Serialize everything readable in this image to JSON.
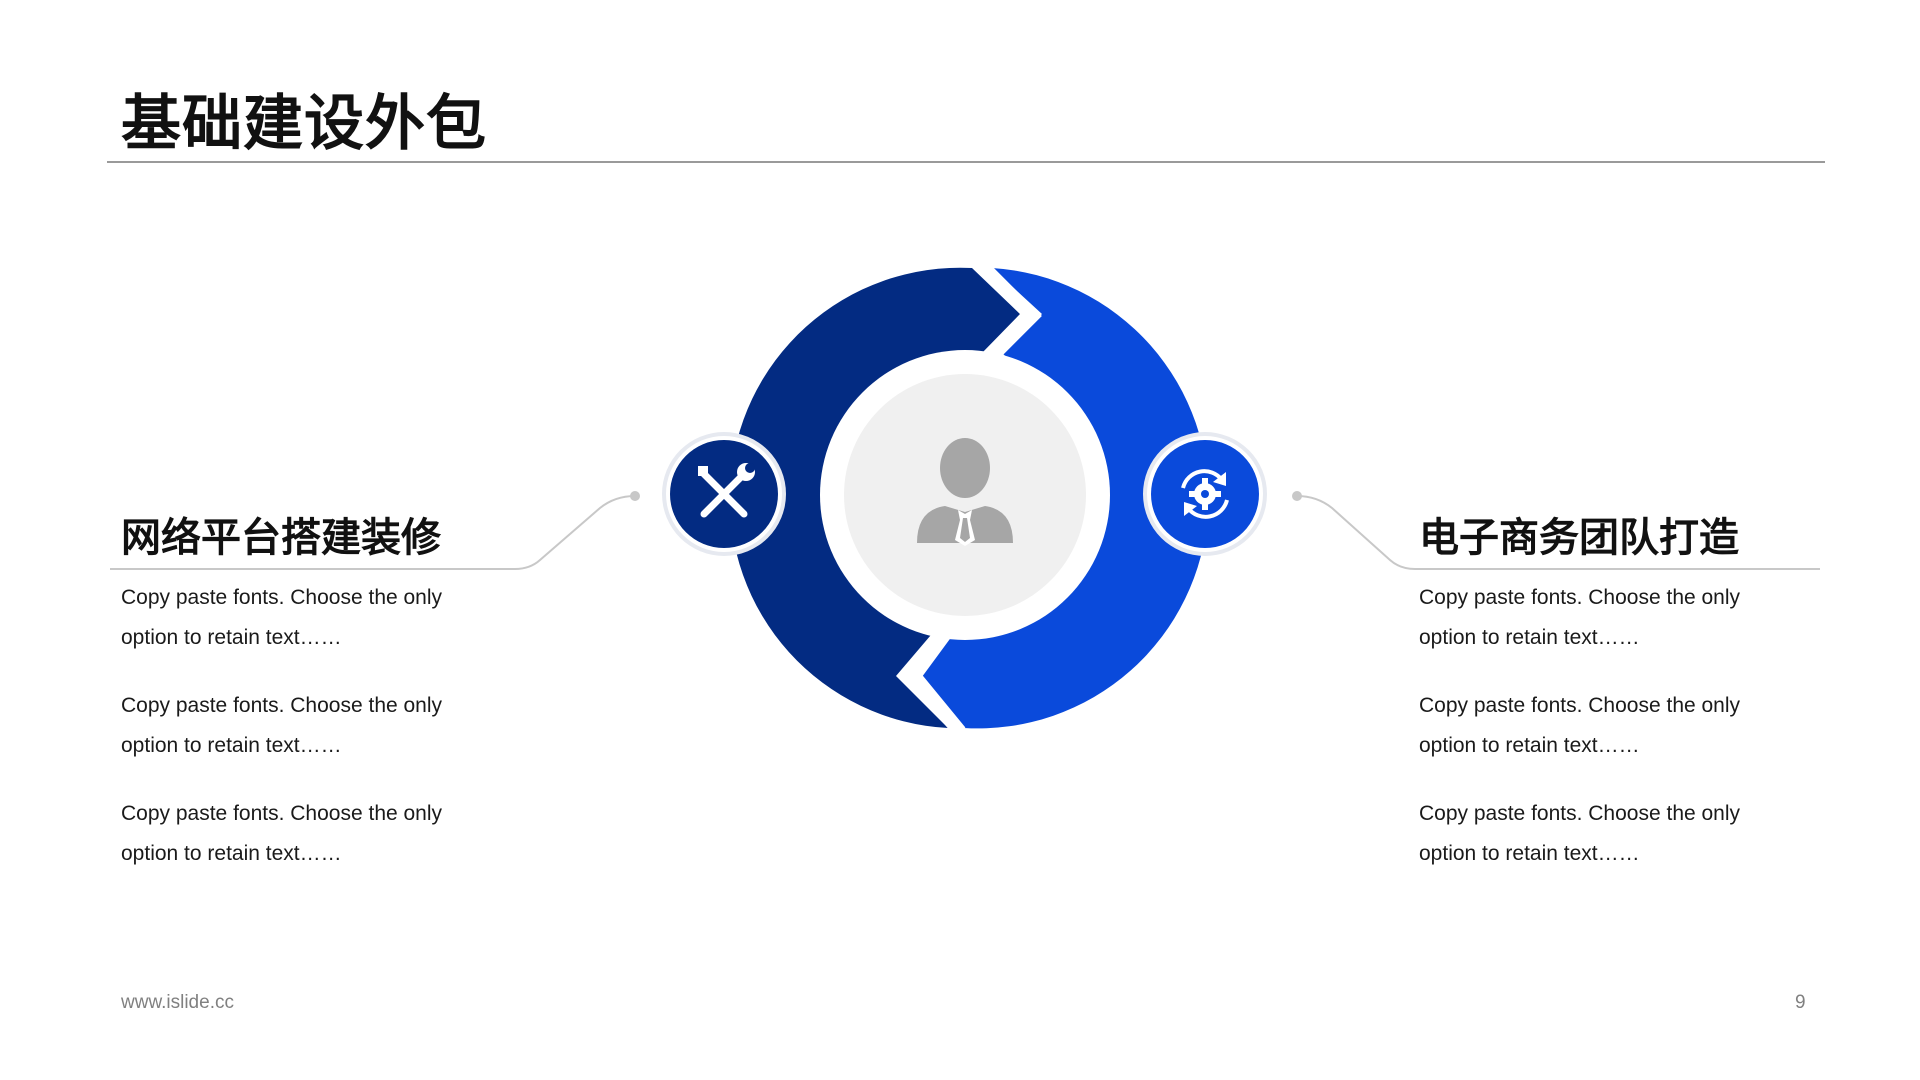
{
  "header": {
    "title": "基础建设外包"
  },
  "left": {
    "heading": "网络平台搭建装修",
    "paragraphs": [
      "Copy paste fonts. Choose the only option to retain text……",
      "Copy paste fonts. Choose the only option to retain text……",
      "Copy paste fonts. Choose the only option to retain text……"
    ],
    "icon": "tools-icon"
  },
  "right": {
    "heading": "电子商务团队打造",
    "paragraphs": [
      "Copy paste fonts. Choose the only option to retain text……",
      "Copy paste fonts. Choose the only option to retain text……",
      "Copy paste fonts. Choose the only option to retain text……"
    ],
    "icon": "gear-refresh-icon"
  },
  "center": {
    "icon": "person-icon"
  },
  "colors": {
    "dark_blue": "#032B82",
    "bright_blue": "#0A4ADB",
    "center_fill": "#F0F0F0",
    "person_gray": "#A6A6A6",
    "connector_gray": "#C8C8C8"
  },
  "footer": {
    "url": "www.islide.cc",
    "page": "9"
  }
}
